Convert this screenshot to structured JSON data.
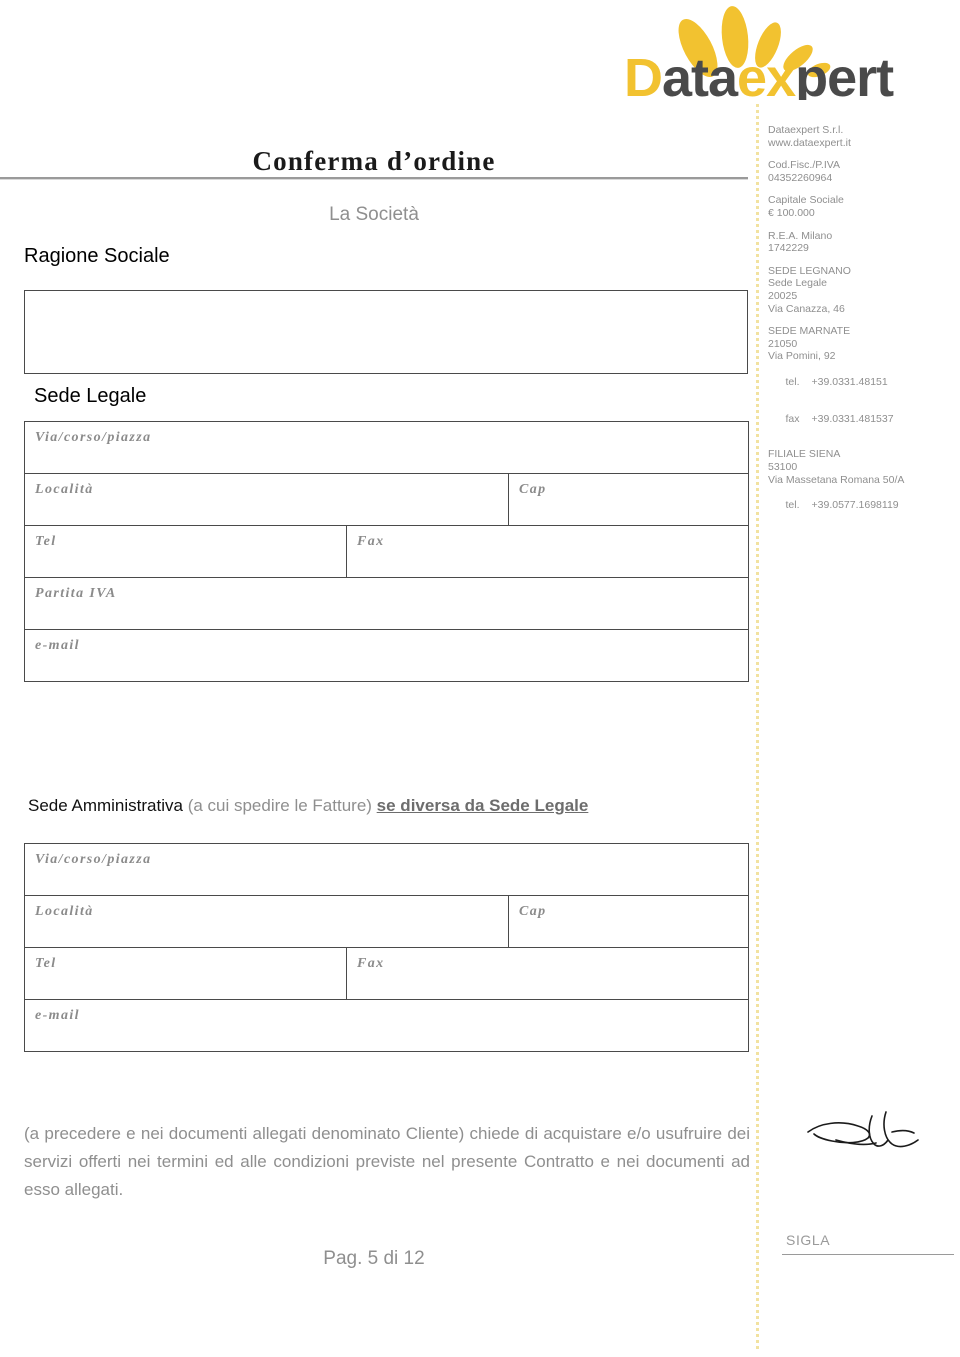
{
  "logo": {
    "name": "dataexpert-logo",
    "text_first": "Data",
    "text_second": "expert",
    "accent_color": "#F2C230",
    "dark_color": "#4A4A4A"
  },
  "company_info": {
    "blocks": [
      {
        "lines": [
          "Dataexpert S.r.l.",
          "www.dataexpert.it"
        ]
      },
      {
        "lines": [
          "Cod.Fisc./P.IVA",
          "04352260964"
        ]
      },
      {
        "lines": [
          "Capitale Sociale",
          "€ 100.000"
        ]
      },
      {
        "lines": [
          "R.E.A. Milano",
          "1742229"
        ]
      },
      {
        "lines": [
          "SEDE LEGNANO",
          "Sede Legale",
          "20025",
          "Via Canazza, 46"
        ]
      },
      {
        "lines": [
          "SEDE MARNATE",
          "21050",
          "Via Pomini, 92"
        ],
        "contacts": [
          {
            "label": "tel.",
            "value": "+39.0331.48151"
          },
          {
            "label": "fax",
            "value": "+39.0331.481537"
          }
        ]
      },
      {
        "lines": [
          "FILIALE SIENA",
          "53100",
          "Via Massetana Romana 50/A"
        ],
        "contacts": [
          {
            "label": "tel.",
            "value": "+39.0577.1698119"
          }
        ]
      }
    ]
  },
  "document": {
    "title": "Conferma d’ordine",
    "subtitle": "La Società"
  },
  "sections": {
    "ragione_sociale_label": "Ragione Sociale",
    "sede_legale_label": "Sede Legale",
    "sede_amministrativa": {
      "strong": "Sede Amministrativa",
      "muted": "(a cui spedire le Fatture)",
      "underlined": "se diversa da Sede Legale"
    }
  },
  "form_fields": {
    "via": "Via/corso/piazza",
    "localita": "Località",
    "cap": "Cap",
    "tel": "Tel",
    "fax": "Fax",
    "partita_iva": "Partita IVA",
    "email": "e-mail"
  },
  "closing_paragraph": "(a precedere e nei documenti allegati denominato Cliente) chiede di acquistare e/o usufruire dei servizi offerti nei termini ed alle condizioni previste nel presente Contratto e nei documenti ad esso allegati.",
  "signature": {
    "sigla_label": "SIGLA"
  },
  "footer": {
    "page_text": "Pag. 5 di 12"
  }
}
